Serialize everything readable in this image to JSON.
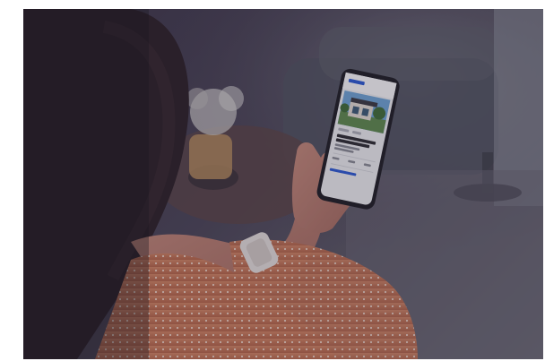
{
  "scene": {
    "phone_app": {
      "app_name": "",
      "property_title": "",
      "property_line2": "",
      "meta": "",
      "link": ""
    }
  },
  "colors": {
    "accent": "#2a5bd7",
    "dress": "#d9835c",
    "background": "#3f3a4b"
  },
  "icon_names": [
    "watch",
    "phone",
    "house-photo"
  ]
}
